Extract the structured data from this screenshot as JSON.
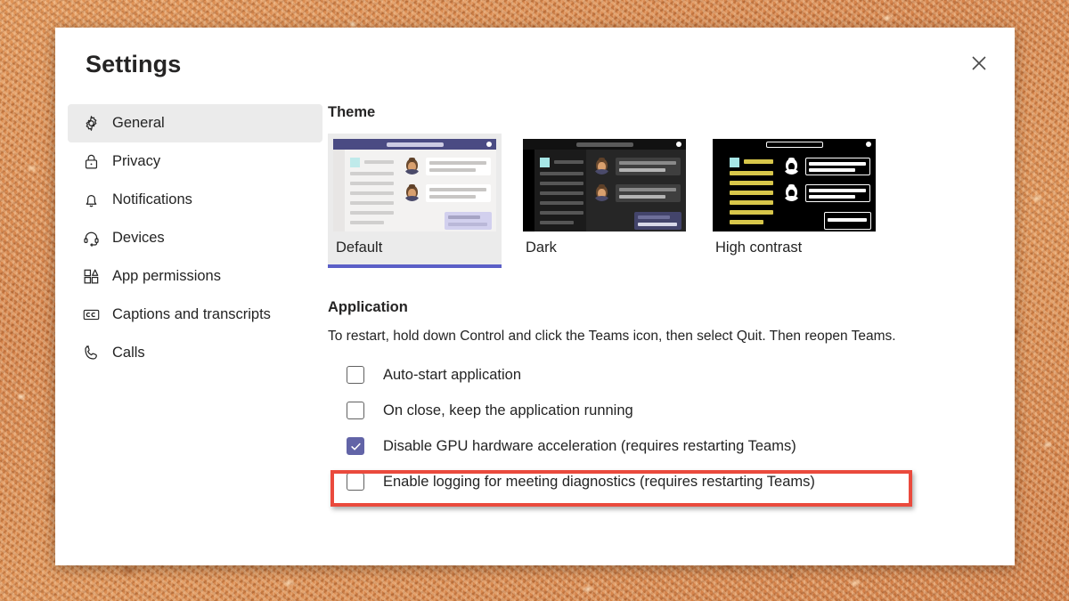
{
  "window": {
    "title": "Settings",
    "close_icon": "close-icon"
  },
  "sidebar": {
    "items": [
      {
        "label": "General",
        "icon": "gear-icon",
        "selected": true
      },
      {
        "label": "Privacy",
        "icon": "lock-icon",
        "selected": false
      },
      {
        "label": "Notifications",
        "icon": "bell-icon",
        "selected": false
      },
      {
        "label": "Devices",
        "icon": "headset-icon",
        "selected": false
      },
      {
        "label": "App permissions",
        "icon": "apps-icon",
        "selected": false
      },
      {
        "label": "Captions and transcripts",
        "icon": "cc-icon",
        "selected": false
      },
      {
        "label": "Calls",
        "icon": "phone-icon",
        "selected": false
      }
    ]
  },
  "theme": {
    "heading": "Theme",
    "options": [
      {
        "name": "Default",
        "selected": true
      },
      {
        "name": "Dark",
        "selected": false
      },
      {
        "name": "High contrast",
        "selected": false
      }
    ]
  },
  "application": {
    "heading": "Application",
    "description": "To restart, hold down Control and click the Teams icon, then select Quit. Then reopen Teams.",
    "checkboxes": [
      {
        "label": "Auto-start application",
        "checked": false,
        "highlighted": false
      },
      {
        "label": "On close, keep the application running",
        "checked": false,
        "highlighted": false
      },
      {
        "label": "Disable GPU hardware acceleration (requires restarting Teams)",
        "checked": true,
        "highlighted": true
      },
      {
        "label": "Enable logging for meeting diagnostics (requires restarting Teams)",
        "checked": false,
        "highlighted": false
      }
    ]
  },
  "colors": {
    "accent": "#6264a7",
    "selected_underline": "#5b5fc7",
    "highlight_border": "#ea4a3d",
    "sidebar_selected_bg": "#ebebeb",
    "text": "#242424",
    "corkboard": "#d9884c",
    "theme_default_titlebar": "#4a4b83",
    "theme_dark_bg": "#1f1f1f",
    "theme_highcontrast_accent": "#d7c64a"
  }
}
